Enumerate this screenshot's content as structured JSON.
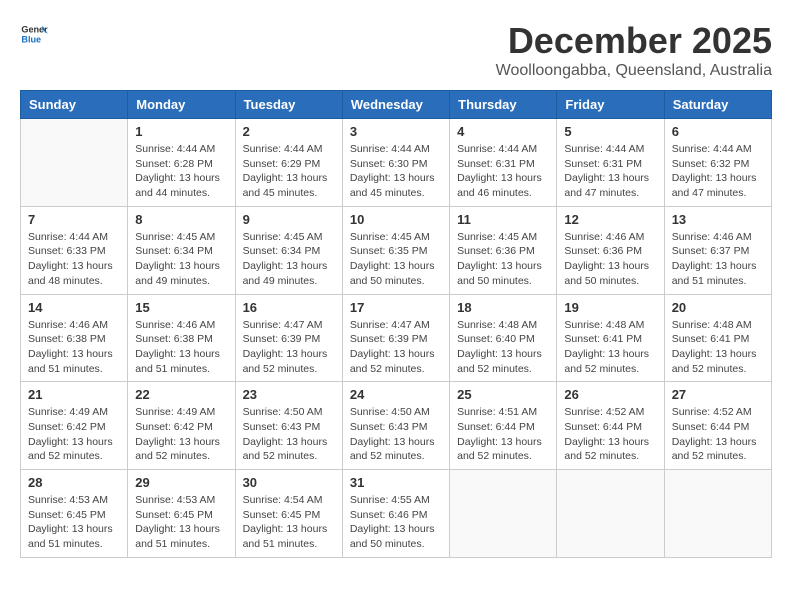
{
  "header": {
    "logo_general": "General",
    "logo_blue": "Blue",
    "month_title": "December 2025",
    "location": "Woolloongabba, Queensland, Australia"
  },
  "days_of_week": [
    "Sunday",
    "Monday",
    "Tuesday",
    "Wednesday",
    "Thursday",
    "Friday",
    "Saturday"
  ],
  "weeks": [
    [
      {
        "day": "",
        "content": ""
      },
      {
        "day": "1",
        "content": "Sunrise: 4:44 AM\nSunset: 6:28 PM\nDaylight: 13 hours\nand 44 minutes."
      },
      {
        "day": "2",
        "content": "Sunrise: 4:44 AM\nSunset: 6:29 PM\nDaylight: 13 hours\nand 45 minutes."
      },
      {
        "day": "3",
        "content": "Sunrise: 4:44 AM\nSunset: 6:30 PM\nDaylight: 13 hours\nand 45 minutes."
      },
      {
        "day": "4",
        "content": "Sunrise: 4:44 AM\nSunset: 6:31 PM\nDaylight: 13 hours\nand 46 minutes."
      },
      {
        "day": "5",
        "content": "Sunrise: 4:44 AM\nSunset: 6:31 PM\nDaylight: 13 hours\nand 47 minutes."
      },
      {
        "day": "6",
        "content": "Sunrise: 4:44 AM\nSunset: 6:32 PM\nDaylight: 13 hours\nand 47 minutes."
      }
    ],
    [
      {
        "day": "7",
        "content": "Sunrise: 4:44 AM\nSunset: 6:33 PM\nDaylight: 13 hours\nand 48 minutes."
      },
      {
        "day": "8",
        "content": "Sunrise: 4:45 AM\nSunset: 6:34 PM\nDaylight: 13 hours\nand 49 minutes."
      },
      {
        "day": "9",
        "content": "Sunrise: 4:45 AM\nSunset: 6:34 PM\nDaylight: 13 hours\nand 49 minutes."
      },
      {
        "day": "10",
        "content": "Sunrise: 4:45 AM\nSunset: 6:35 PM\nDaylight: 13 hours\nand 50 minutes."
      },
      {
        "day": "11",
        "content": "Sunrise: 4:45 AM\nSunset: 6:36 PM\nDaylight: 13 hours\nand 50 minutes."
      },
      {
        "day": "12",
        "content": "Sunrise: 4:46 AM\nSunset: 6:36 PM\nDaylight: 13 hours\nand 50 minutes."
      },
      {
        "day": "13",
        "content": "Sunrise: 4:46 AM\nSunset: 6:37 PM\nDaylight: 13 hours\nand 51 minutes."
      }
    ],
    [
      {
        "day": "14",
        "content": "Sunrise: 4:46 AM\nSunset: 6:38 PM\nDaylight: 13 hours\nand 51 minutes."
      },
      {
        "day": "15",
        "content": "Sunrise: 4:46 AM\nSunset: 6:38 PM\nDaylight: 13 hours\nand 51 minutes."
      },
      {
        "day": "16",
        "content": "Sunrise: 4:47 AM\nSunset: 6:39 PM\nDaylight: 13 hours\nand 52 minutes."
      },
      {
        "day": "17",
        "content": "Sunrise: 4:47 AM\nSunset: 6:39 PM\nDaylight: 13 hours\nand 52 minutes."
      },
      {
        "day": "18",
        "content": "Sunrise: 4:48 AM\nSunset: 6:40 PM\nDaylight: 13 hours\nand 52 minutes."
      },
      {
        "day": "19",
        "content": "Sunrise: 4:48 AM\nSunset: 6:41 PM\nDaylight: 13 hours\nand 52 minutes."
      },
      {
        "day": "20",
        "content": "Sunrise: 4:48 AM\nSunset: 6:41 PM\nDaylight: 13 hours\nand 52 minutes."
      }
    ],
    [
      {
        "day": "21",
        "content": "Sunrise: 4:49 AM\nSunset: 6:42 PM\nDaylight: 13 hours\nand 52 minutes."
      },
      {
        "day": "22",
        "content": "Sunrise: 4:49 AM\nSunset: 6:42 PM\nDaylight: 13 hours\nand 52 minutes."
      },
      {
        "day": "23",
        "content": "Sunrise: 4:50 AM\nSunset: 6:43 PM\nDaylight: 13 hours\nand 52 minutes."
      },
      {
        "day": "24",
        "content": "Sunrise: 4:50 AM\nSunset: 6:43 PM\nDaylight: 13 hours\nand 52 minutes."
      },
      {
        "day": "25",
        "content": "Sunrise: 4:51 AM\nSunset: 6:44 PM\nDaylight: 13 hours\nand 52 minutes."
      },
      {
        "day": "26",
        "content": "Sunrise: 4:52 AM\nSunset: 6:44 PM\nDaylight: 13 hours\nand 52 minutes."
      },
      {
        "day": "27",
        "content": "Sunrise: 4:52 AM\nSunset: 6:44 PM\nDaylight: 13 hours\nand 52 minutes."
      }
    ],
    [
      {
        "day": "28",
        "content": "Sunrise: 4:53 AM\nSunset: 6:45 PM\nDaylight: 13 hours\nand 51 minutes."
      },
      {
        "day": "29",
        "content": "Sunrise: 4:53 AM\nSunset: 6:45 PM\nDaylight: 13 hours\nand 51 minutes."
      },
      {
        "day": "30",
        "content": "Sunrise: 4:54 AM\nSunset: 6:45 PM\nDaylight: 13 hours\nand 51 minutes."
      },
      {
        "day": "31",
        "content": "Sunrise: 4:55 AM\nSunset: 6:46 PM\nDaylight: 13 hours\nand 50 minutes."
      },
      {
        "day": "",
        "content": ""
      },
      {
        "day": "",
        "content": ""
      },
      {
        "day": "",
        "content": ""
      }
    ]
  ]
}
